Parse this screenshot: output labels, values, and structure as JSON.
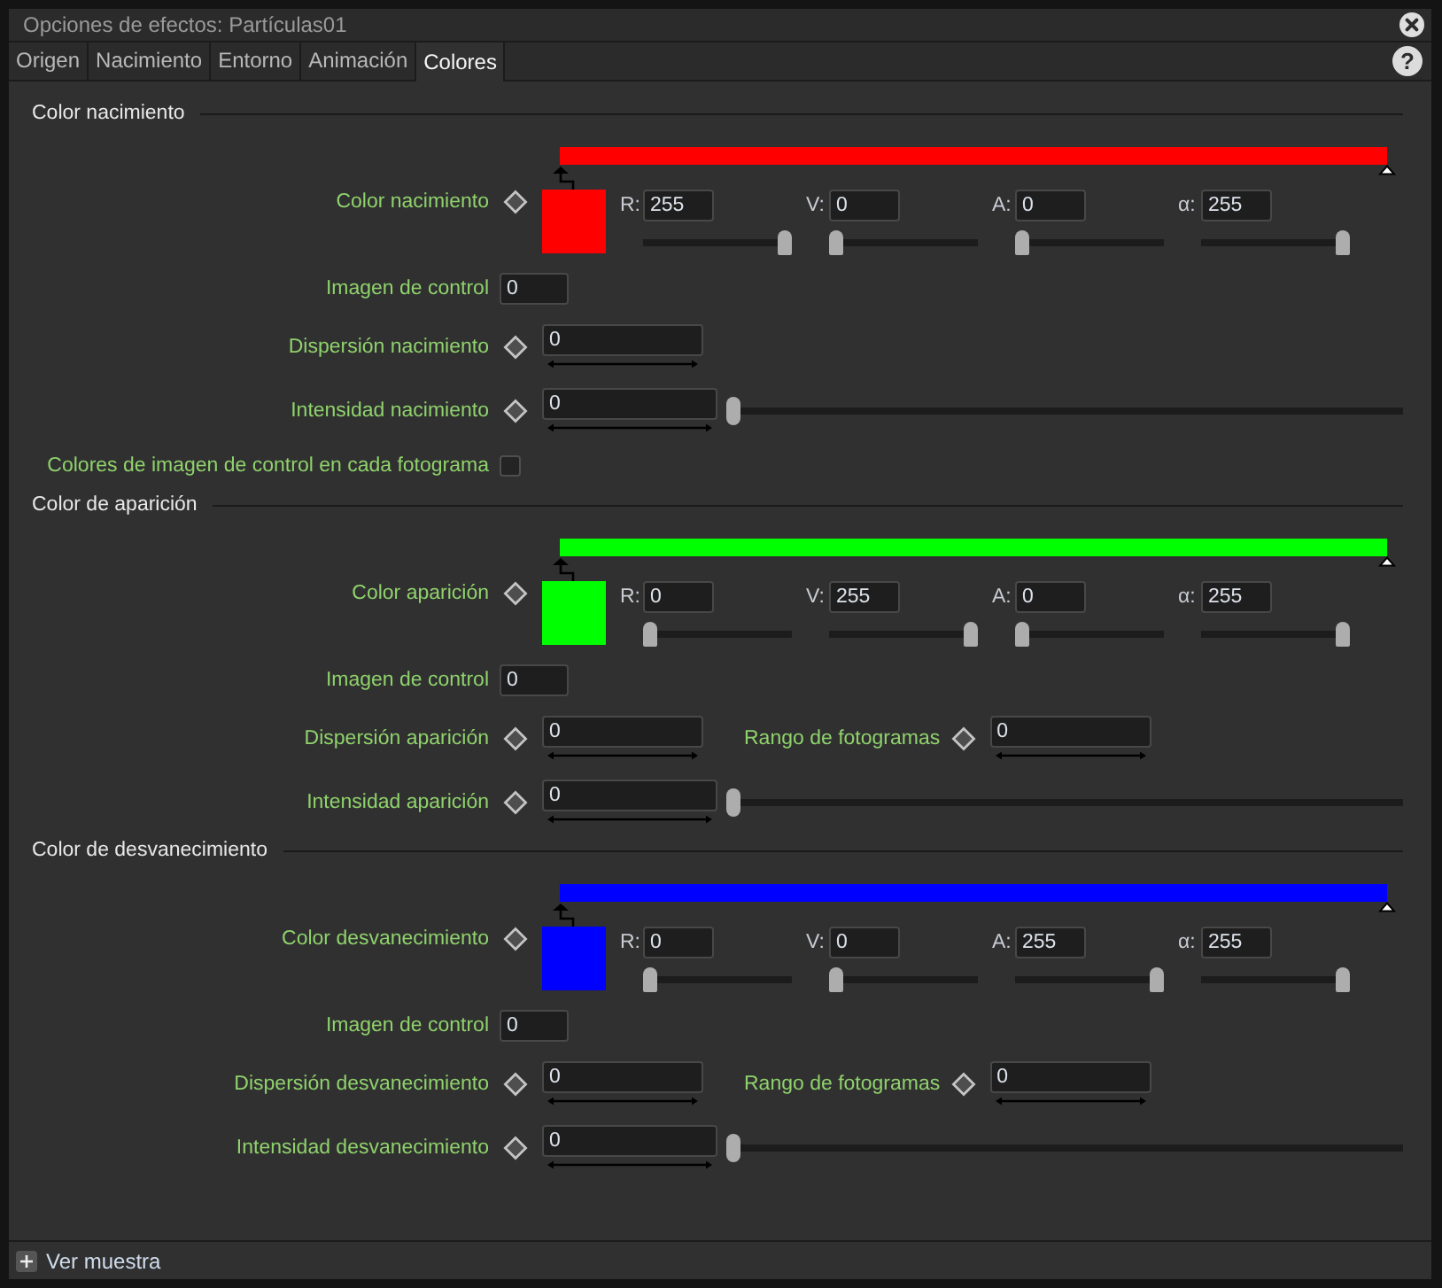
{
  "window": {
    "title": "Opciones de efectos: Partículas01"
  },
  "tabs": [
    {
      "label": "Origen",
      "selected": false
    },
    {
      "label": "Nacimiento",
      "selected": false
    },
    {
      "label": "Entorno",
      "selected": false
    },
    {
      "label": "Animación",
      "selected": false
    },
    {
      "label": "Colores",
      "selected": true
    }
  ],
  "help_button": {
    "label": "?"
  },
  "sections": [
    {
      "title": "Color nacimiento",
      "color_row": {
        "label": "Color nacimiento",
        "channels": [
          {
            "label": "R:",
            "value": "255",
            "level": 1
          },
          {
            "label": "V:",
            "value": "0",
            "level": 0
          },
          {
            "label": "A:",
            "value": "0",
            "level": 0
          },
          {
            "label": "α:",
            "value": "255",
            "level": 1
          }
        ]
      },
      "rows": [
        {
          "kind": "field",
          "label": "Imagen de control",
          "value": "0"
        },
        {
          "kind": "range",
          "label": "Dispersión nacimiento",
          "value": "0"
        },
        {
          "kind": "slider",
          "label": "Intensidad nacimiento",
          "value": "0",
          "level": 0
        },
        {
          "kind": "checkbox",
          "label": "Colores de imagen de control en cada fotograma",
          "checked": false
        }
      ]
    },
    {
      "title": "Color de aparición",
      "color_row": {
        "label": "Color aparición",
        "channels": [
          {
            "label": "R:",
            "value": "0",
            "level": 0
          },
          {
            "label": "V:",
            "value": "255",
            "level": 1
          },
          {
            "label": "A:",
            "value": "0",
            "level": 0
          },
          {
            "label": "α:",
            "value": "255",
            "level": 1
          }
        ]
      },
      "rows": [
        {
          "kind": "field",
          "label": "Imagen de control",
          "value": "0"
        },
        {
          "kind": "range",
          "label": "Dispersión aparición",
          "value": "0",
          "extra": {
            "label": "Rango de fotogramas",
            "value": "0"
          }
        },
        {
          "kind": "slider",
          "label": "Intensidad aparición",
          "value": "0",
          "level": 0
        }
      ]
    },
    {
      "title": "Color de desvanecimiento",
      "color_row": {
        "label": "Color desvanecimiento",
        "channels": [
          {
            "label": "R:",
            "value": "0",
            "level": 0
          },
          {
            "label": "V:",
            "value": "0",
            "level": 0
          },
          {
            "label": "A:",
            "value": "255",
            "level": 1
          },
          {
            "label": "α:",
            "value": "255",
            "level": 1
          }
        ]
      },
      "rows": [
        {
          "kind": "field",
          "label": "Imagen de control",
          "value": "0"
        },
        {
          "kind": "range",
          "label": "Dispersión desvanecimiento",
          "value": "0",
          "extra": {
            "label": "Rango de fotogramas",
            "value": "0"
          }
        },
        {
          "kind": "slider",
          "label": "Intensidad desvanecimiento",
          "value": "0",
          "level": 0
        }
      ]
    }
  ],
  "footer": {
    "label": "Ver muestra"
  }
}
